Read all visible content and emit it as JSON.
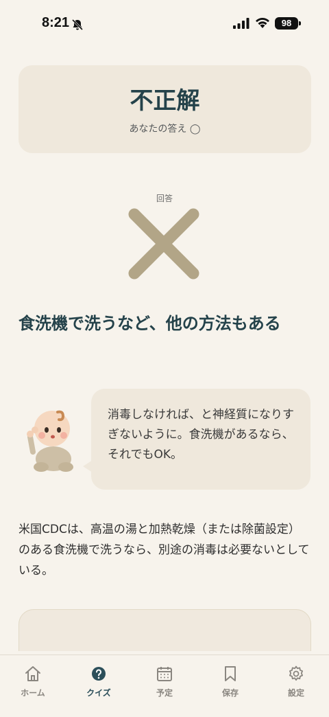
{
  "status": {
    "time": "8:21",
    "battery": "98",
    "icons": [
      "bell-off-icon",
      "signal-icon",
      "wifi-icon",
      "battery-icon"
    ]
  },
  "result": {
    "title": "不正解",
    "your_answer": "あなたの答え ◯"
  },
  "answer": {
    "label": "回答",
    "mark": "×"
  },
  "headline": "食洗機で洗うなど、他の方法もある",
  "speech": {
    "text": "消毒しなければ、と神経質になりすぎないように。食洗機があるなら、それでもOK。",
    "avatar": "baby-icon"
  },
  "body_text": "米国CDCは、高温の湯と加熱乾燥（または除菌設定）のある食洗機で洗うなら、別途の消毒は必要ないとしている。",
  "colors": {
    "background": "#f7f3ec",
    "card": "#efe8dc",
    "accent": "#24424a",
    "cross": "#b2a587"
  },
  "tabs": [
    {
      "label": "ホーム",
      "icon": "home-icon",
      "active": false
    },
    {
      "label": "クイズ",
      "icon": "quiz-icon",
      "active": true
    },
    {
      "label": "予定",
      "icon": "calendar-icon",
      "active": false
    },
    {
      "label": "保存",
      "icon": "bookmark-icon",
      "active": false
    },
    {
      "label": "設定",
      "icon": "settings-icon",
      "active": false
    }
  ]
}
